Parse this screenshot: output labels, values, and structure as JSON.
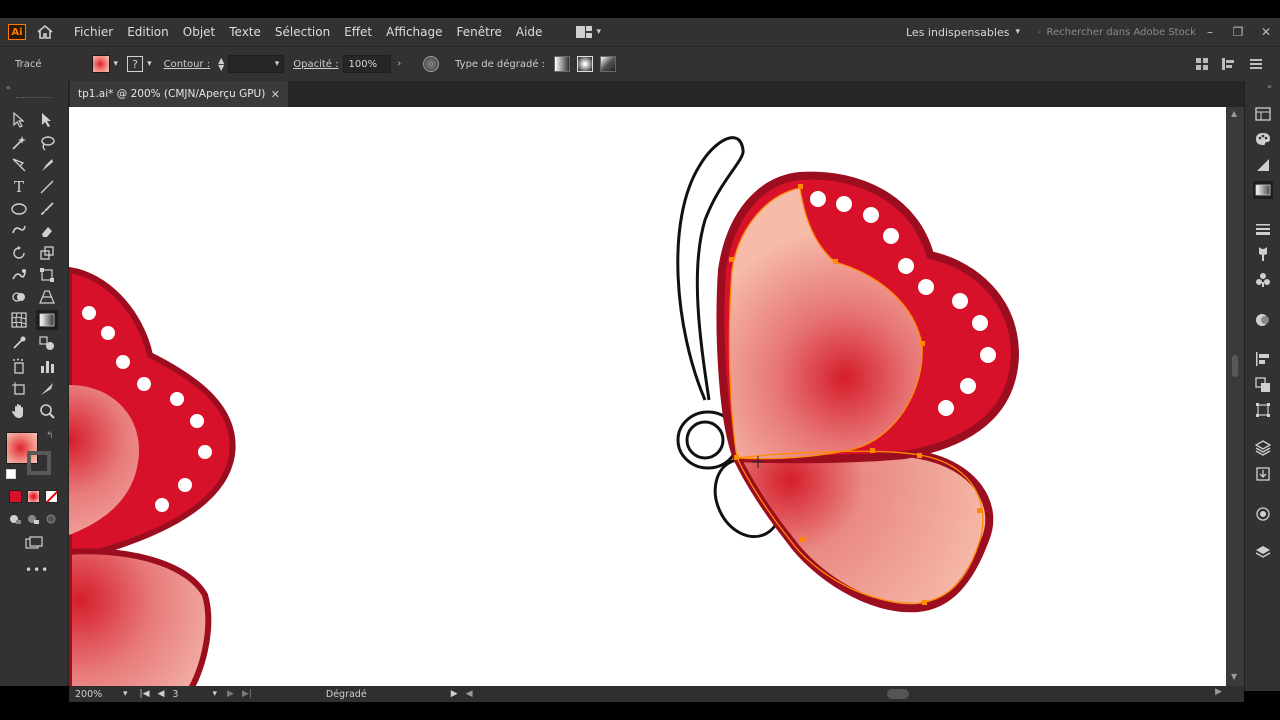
{
  "app": {
    "logo_text": "Ai",
    "menu": [
      "Fichier",
      "Edition",
      "Objet",
      "Texte",
      "Sélection",
      "Effet",
      "Affichage",
      "Fenêtre",
      "Aide"
    ],
    "workspace": "Les indispensables",
    "search_placeholder": "Rechercher dans Adobe Stock"
  },
  "control": {
    "selection_label": "Tracé",
    "stroke_label": "Contour :",
    "opacity_label": "Opacité :",
    "opacity_value": "100%",
    "gradient_type_label": "Type de dégradé :"
  },
  "document": {
    "tab_title": "tp1.ai* @ 200% (CMJN/Aperçu GPU)"
  },
  "status": {
    "zoom": "200%",
    "artboard": "3",
    "tool_name": "Dégradé"
  },
  "colors": {
    "chrome": "#323232",
    "wing_red": "#d8112a",
    "wing_outline": "#9c0d1f",
    "wing_light": "#f4b9a6",
    "selection": "#ff8a00"
  }
}
